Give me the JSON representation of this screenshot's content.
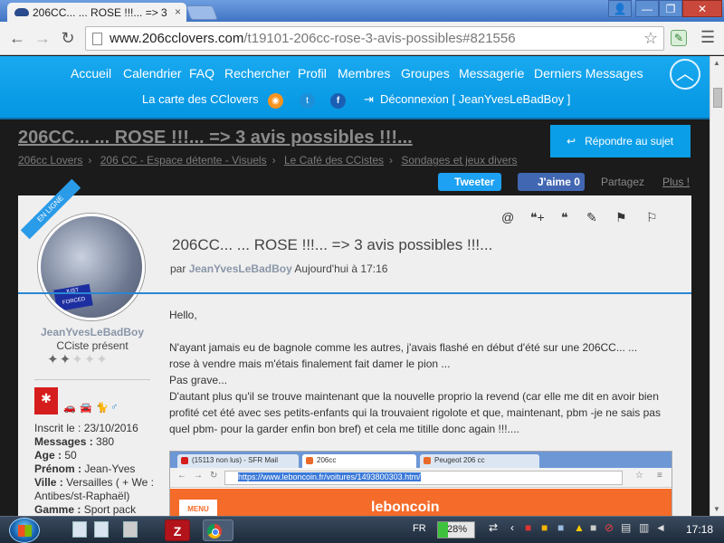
{
  "browser": {
    "tab_title": "206CC... ... ROSE !!!... => 3",
    "tab_close": "×",
    "url_domain": "www.206cclovers.com",
    "url_path": "/t19101-206cc-rose-3-avis-possibles#821556",
    "star_icon": "star-icon",
    "menu_icon": "☰"
  },
  "window": {
    "user": "👤",
    "minimize": "—",
    "maximize": "❐",
    "close": "✕"
  },
  "nav": {
    "row1": [
      "Accueil",
      "Calendrier",
      "FAQ",
      "Rechercher",
      "Profil",
      "Membres",
      "Groupes",
      "Messagerie",
      "Derniers Messages"
    ],
    "row2_label": "La carte des CClovers",
    "logout": "Déconnexion [ JeanYvesLeBadBoy ]"
  },
  "topic": {
    "title": "206CC... ... ROSE !!!... => 3 avis possibles !!!...",
    "reply_button": "Répondre au sujet",
    "breadcrumb": [
      "206cc Lovers",
      "206 CC - Espace détente - Visuels",
      "Le Café des CCistes",
      "Sondages et jeux divers"
    ],
    "tweet": "Tweeter",
    "like": "J'aime 0",
    "share": "Partagez",
    "more": "Plus !"
  },
  "post": {
    "online_badge": "EN LIGNE",
    "avatar_sticker": "JUST FORCED",
    "username": "JeanYvesLeBadBoy",
    "rank": "CCiste présent",
    "stars_full": "✦✦",
    "stars_empty": "✦✦✦",
    "profile": {
      "registered_label": "Inscrit le :",
      "registered": "23/10/2016",
      "messages_label": "Messages :",
      "messages": "380",
      "age_label": "Age :",
      "age": "50",
      "firstname_label": "Prénom :",
      "firstname": "Jean-Yves",
      "city_label": "Ville :",
      "city": "Versailles ( + We : Antibes/st-Raphaël)",
      "range_label": "Gamme :",
      "range": "Sport pack"
    },
    "title": "206CC... ... ROSE !!!... => 3 avis possibles !!!...",
    "meta_by": "par",
    "meta_author": "JeanYvesLeBadBoy",
    "meta_date": "Aujourd'hui à 17:16",
    "body": {
      "greeting": "Hello,",
      "p1_line1": "N'ayant jamais eu de bagnole comme les autres, j'avais flashé en début d'été sur une 206CC... ...",
      "p1_line2": "rose à vendre mais m'étais finalement fait damer le pion ...",
      "p2": "Pas grave...",
      "p3": "D'autant plus qu'il se trouve maintenant que la nouvelle proprio la revend (car elle me dit en avoir bien profité cet été avec ses petits-enfants qui la trouvaient rigolote et que, maintenant, pbm -je ne sais pas quel pbm- pour la garder enfin bon bref) et cela me titille donc again !!!...."
    },
    "screenshot": {
      "tab1": "(15113 non lus) - SFR Mail",
      "tab2": "206cc",
      "tab3": "Peugeot 206 cc",
      "url": "https://www.leboncoin.fr/voitures/1493800303.htm/",
      "menu": "MENU",
      "logo": "leboncoin"
    }
  },
  "taskbar": {
    "filezilla": "Z",
    "language": "FR",
    "battery": "28%",
    "time": "17:18"
  },
  "colors": {
    "nav_blue": "#0b9ee8",
    "accent_blue": "#2a86d5",
    "page_bg": "#1b1b1b"
  }
}
